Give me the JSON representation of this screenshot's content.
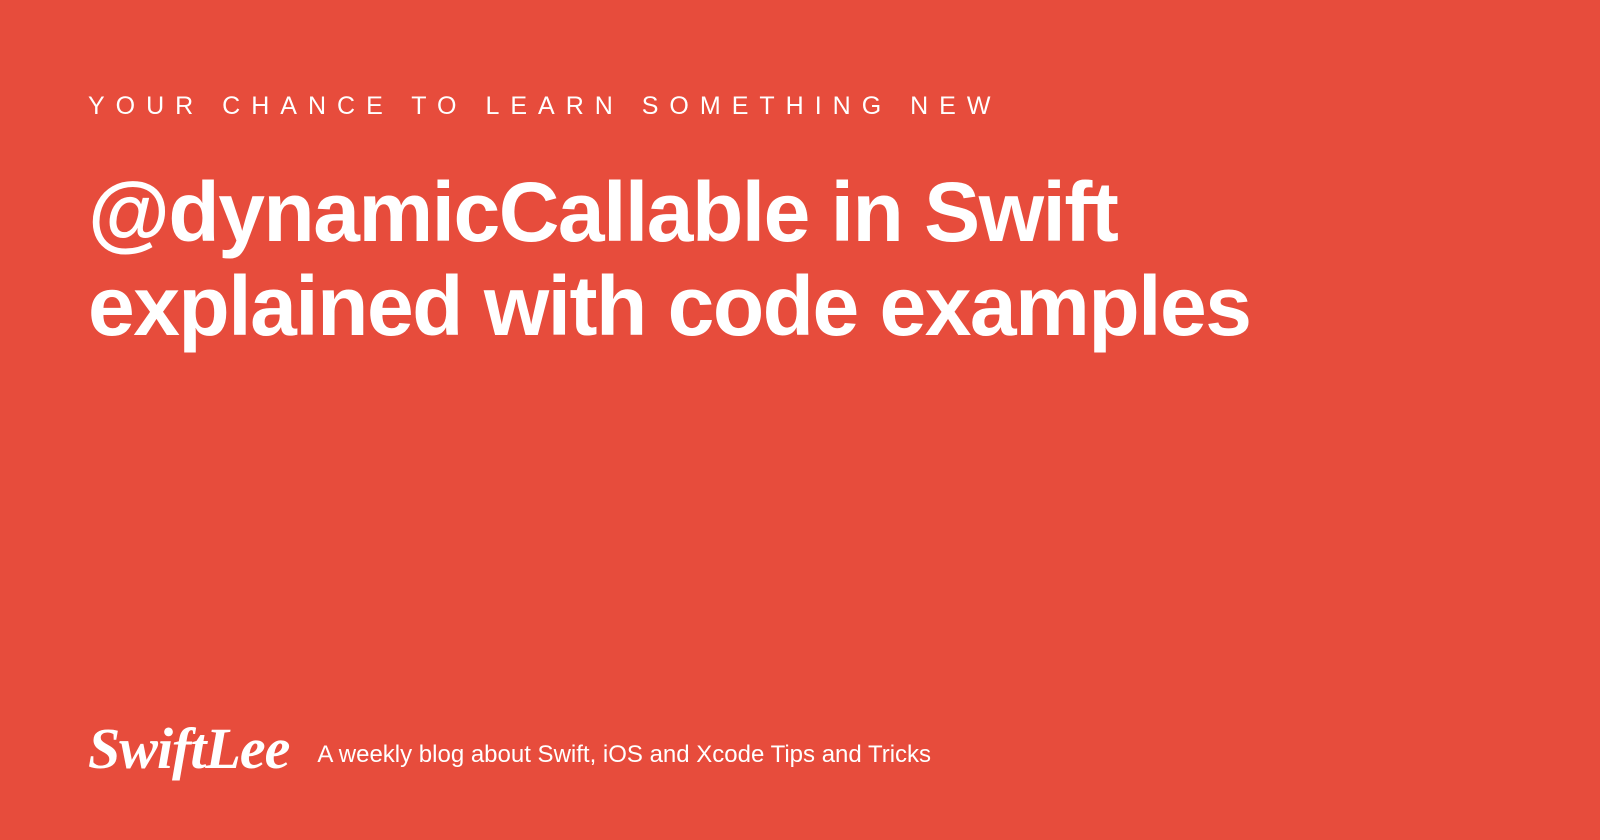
{
  "eyebrow": "YOUR CHANCE TO LEARN SOMETHING NEW",
  "headline": "@dynamicCallable in Swift explained with code examples",
  "footer": {
    "logo": "SwiftLee",
    "tagline": "A weekly blog about Swift, iOS and Xcode Tips and Tricks"
  }
}
